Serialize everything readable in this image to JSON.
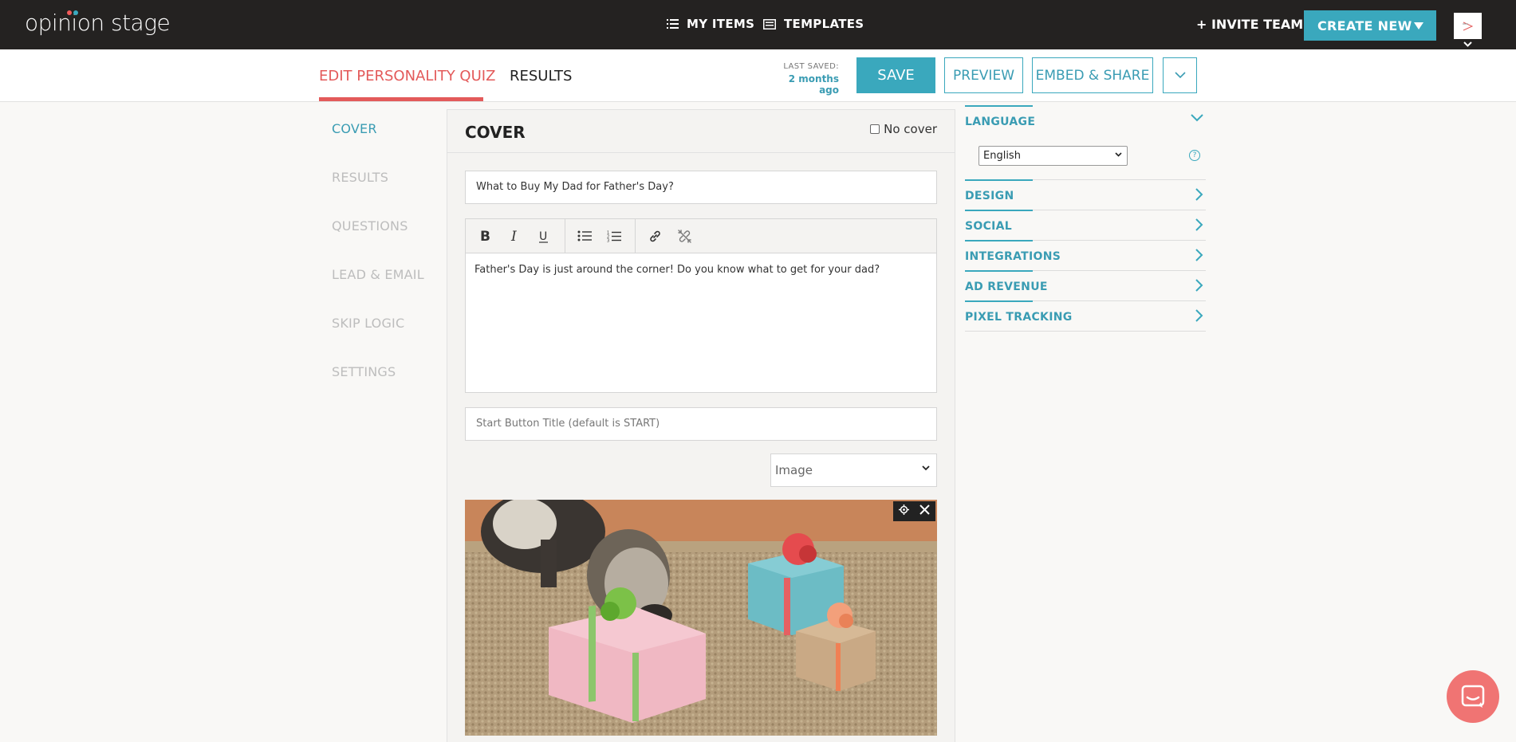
{
  "topbar": {
    "logo": "opinion stage",
    "my_items": "MY ITEMS",
    "templates": "TEMPLATES",
    "invite": "+ INVITE TEAM",
    "create_new": "CREATE NEW"
  },
  "subheader": {
    "tab_edit": "EDIT PERSONALITY QUIZ",
    "tab_results": "RESULTS",
    "last_saved_label": "LAST SAVED:",
    "last_saved_value": "2 months ago",
    "save": "SAVE",
    "preview": "PREVIEW",
    "embed_share": "EMBED & SHARE"
  },
  "leftnav": {
    "items": [
      {
        "label": "COVER"
      },
      {
        "label": "RESULTS"
      },
      {
        "label": "QUESTIONS"
      },
      {
        "label": "LEAD & EMAIL"
      },
      {
        "label": "SKIP LOGIC"
      },
      {
        "label": "SETTINGS"
      }
    ]
  },
  "cover": {
    "title": "COVER",
    "no_cover_label": "No cover",
    "quiz_title": "What to Buy My Dad for Father's Day?",
    "description": "Father's Day is just around the corner! Do you know what to get for your dad?",
    "start_button_placeholder": "Start Button Title (default is START)",
    "media_type": "Image"
  },
  "settings": {
    "language_label": "LANGUAGE",
    "language_value": "English",
    "sections": [
      {
        "label": "DESIGN"
      },
      {
        "label": "SOCIAL"
      },
      {
        "label": "INTEGRATIONS"
      },
      {
        "label": "AD REVENUE"
      },
      {
        "label": "PIXEL TRACKING"
      }
    ]
  },
  "colors": {
    "accent": "#3aa8bd",
    "active_tab": "#e35a5a",
    "topbar": "#242221",
    "chat": "#f07473"
  }
}
